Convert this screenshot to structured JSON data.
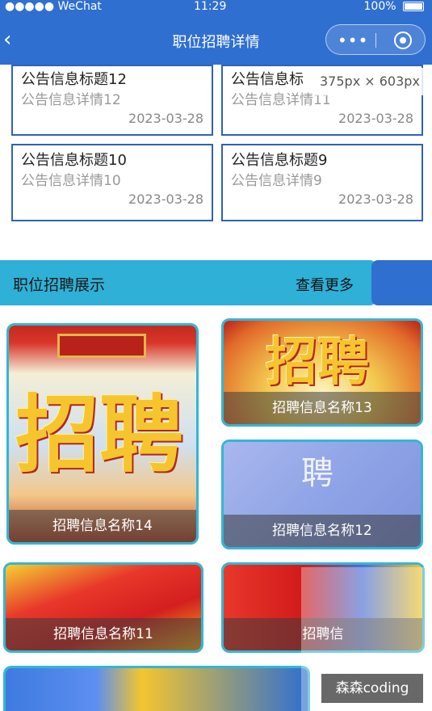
{
  "status": {
    "carrier": "●●●●● WeChat",
    "time": "11:29",
    "battery": "100%"
  },
  "nav": {
    "title": "职位招聘详情",
    "back": "‹",
    "more": "•••"
  },
  "tooltip": "375px × 603px",
  "notices": [
    {
      "title": "公告信息标题12",
      "detail": "公告信息详情12",
      "date": "2023-03-28"
    },
    {
      "title": "公告信息标",
      "detail": "公告信息详情11",
      "date": "2023-03-28"
    },
    {
      "title": "公告信息标题10",
      "detail": "公告信息详情10",
      "date": "2023-03-28"
    },
    {
      "title": "公告信息标题9",
      "detail": "公告信息详情9",
      "date": "2023-03-28"
    }
  ],
  "section": {
    "title": "职位招聘展示",
    "more": "查看更多"
  },
  "jobs": [
    {
      "name": "招聘信息名称14",
      "art": "招聘"
    },
    {
      "name": "招聘信息名称13",
      "art": "招聘"
    },
    {
      "name": "招聘信息名称12",
      "art": "聘"
    },
    {
      "name": "招聘信息名称11"
    },
    {
      "name": "招聘信"
    }
  ],
  "watermark": "森森coding",
  "colors": {
    "nav": "#2f6fd0",
    "accent": "#2fb0d6",
    "card_border": "#33b6d4",
    "notice_border": "#2f62b8"
  }
}
